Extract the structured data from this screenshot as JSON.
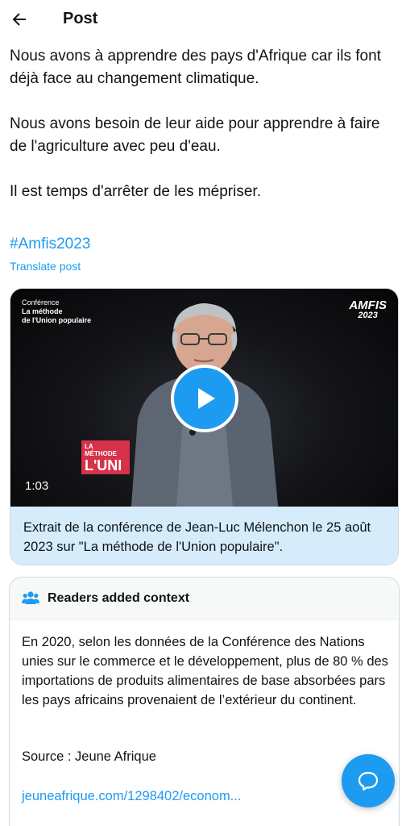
{
  "header": {
    "title": "Post",
    "back_icon": "arrow-left-icon"
  },
  "post": {
    "paragraphs": [
      "Nous avons à apprendre des pays d'Afrique car ils font déjà face au changement climatique.",
      "Nous avons besoin de leur aide pour apprendre à faire de l'agriculture avec peu d'eau.",
      "Il est temps d'arrêter de les mépriser."
    ],
    "hashtag": "#Amfis2023",
    "translate_label": "Translate post"
  },
  "video": {
    "overlay_line1": "Conférence",
    "overlay_line2": "La méthode",
    "overlay_line3": "de l'Union populaire",
    "logo_top": "AMFIS",
    "logo_year": "2023",
    "banner_top": "LA MÉTHODE",
    "banner_big": "L'UNI",
    "duration": "1:03",
    "caption": "Extrait de la conférence de Jean-Luc Mélenchon le 25 août 2023 sur \"La méthode de l'Union populaire\".",
    "play_icon": "play-icon"
  },
  "context": {
    "title": "Readers added context",
    "icon": "people-icon",
    "body": "En 2020, selon les données de la Conférence des Nations unies sur le commerce et le développement, plus de 80 % des importations de produits alimentaires de base absorbées pars les pays africains provenaient de l’extérieur du continent.",
    "source": "Source : Jeune Afrique",
    "link": "jeuneafrique.com/1298402/econom..."
  },
  "fab": {
    "icon": "chat-bubble-icon"
  },
  "colors": {
    "accent": "#1d9bf0",
    "caption_bg": "#d6ecfb",
    "text": "#0f1419"
  }
}
